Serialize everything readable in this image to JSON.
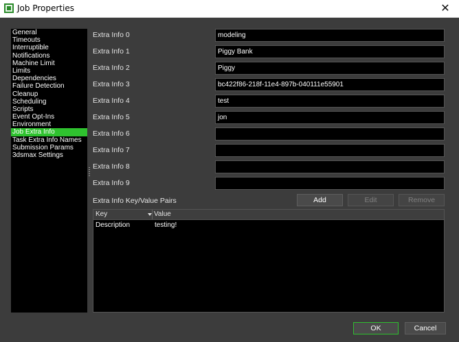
{
  "window": {
    "title": "Job Properties",
    "close_glyph": "✕"
  },
  "nav": {
    "items": [
      "General",
      "Timeouts",
      "Interruptible",
      "Notifications",
      "Machine Limit",
      "Limits",
      "Dependencies",
      "Failure Detection",
      "Cleanup",
      "Scheduling",
      "Scripts",
      "Event Opt-Ins",
      "Environment",
      "Job Extra Info",
      "Task Extra Info Names",
      "Submission Params",
      "3dsmax Settings"
    ],
    "selected": "Job Extra Info"
  },
  "fields": [
    {
      "label": "Extra Info 0",
      "value": "modeling"
    },
    {
      "label": "Extra Info 1",
      "value": "Piggy Bank"
    },
    {
      "label": "Extra Info 2",
      "value": "Piggy"
    },
    {
      "label": "Extra Info 3",
      "value": "bc422f86-218f-11e4-897b-040111e55901"
    },
    {
      "label": "Extra Info 4",
      "value": "test"
    },
    {
      "label": "Extra Info 5",
      "value": "jon"
    },
    {
      "label": "Extra Info 6",
      "value": ""
    },
    {
      "label": "Extra Info 7",
      "value": ""
    },
    {
      "label": "Extra Info 8",
      "value": ""
    },
    {
      "label": "Extra Info 9",
      "value": ""
    }
  ],
  "kv": {
    "label": "Extra Info Key/Value Pairs",
    "add": "Add",
    "edit": "Edit",
    "remove": "Remove",
    "columns": {
      "key": "Key",
      "value": "Value"
    },
    "rows": [
      {
        "key": "Description",
        "value": "testing!"
      }
    ]
  },
  "footer": {
    "ok": "OK",
    "cancel": "Cancel"
  },
  "colors": {
    "accent": "#2fc22f",
    "background": "#3c3c3c",
    "field": "#000000"
  }
}
